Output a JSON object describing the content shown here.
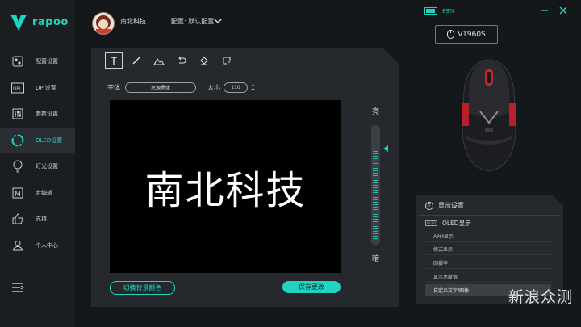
{
  "brand": {
    "name": "rapoo"
  },
  "user": {
    "name": "南北科技",
    "profile_label": "配置: 默认配置"
  },
  "battery": {
    "level": "89%",
    "fraction": 0.89
  },
  "device": {
    "model": "VT960S"
  },
  "sidebar": {
    "items": [
      {
        "label": "配置设置",
        "icon": "config-icon"
      },
      {
        "label": "DPI设置",
        "icon": "dpi-icon"
      },
      {
        "label": "参数设置",
        "icon": "sliders-icon"
      },
      {
        "label": "OLED设置",
        "icon": "oled-icon",
        "active": true
      },
      {
        "label": "灯光设置",
        "icon": "bulb-icon"
      },
      {
        "label": "宏编辑",
        "icon": "macro-icon"
      },
      {
        "label": "支持",
        "icon": "thumb-icon"
      },
      {
        "label": "个人中心",
        "icon": "user-icon"
      }
    ]
  },
  "toolbar": {
    "tools": [
      "text-tool",
      "pen-tool",
      "mountain-tool",
      "undo-tool",
      "eraser-tool",
      "clear-tool"
    ]
  },
  "font": {
    "label": "字体",
    "value": "思源黑体",
    "size_label": "大小",
    "size_value": "110"
  },
  "canvas": {
    "text": "南北科技"
  },
  "brightness": {
    "high_label": "亮",
    "low_label": "暗",
    "level": 0.82
  },
  "buttons": {
    "switch_bg": "切换背景颜色",
    "save": "保存更改"
  },
  "display_panel": {
    "title": "显示设置",
    "section": "OLED显示",
    "badge": "OLED",
    "items": [
      "APM显示",
      "模式显示",
      "回报率",
      "显示亮度值",
      "自定义文字/图像"
    ]
  },
  "watermark": {
    "text": "新浪众测"
  },
  "colors": {
    "accent": "#1fd5c2",
    "background": "#15181b",
    "panel": "#25292d"
  }
}
